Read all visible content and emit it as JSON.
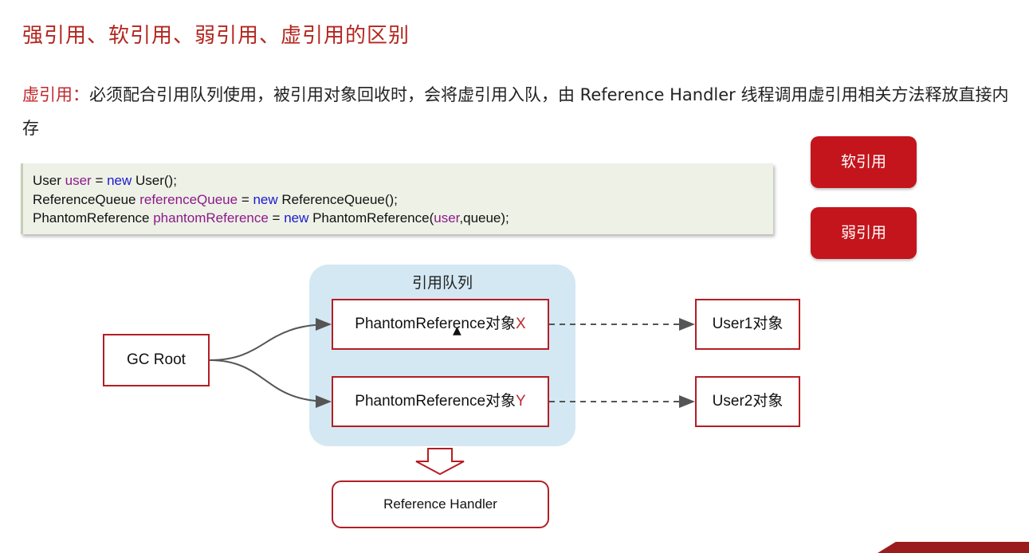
{
  "title": "强引用、软引用、弱引用、虚引用的区别",
  "description": {
    "highlight": "虚引用：",
    "text": "必须配合引用队列使用，被引用对象回收时，会将虚引用入队，由 Reference Handler 线程调用虚引用相关方法释放直接内存"
  },
  "code": {
    "line1": {
      "type": "User",
      "var": "user",
      "eq": " = ",
      "kw": "new",
      "rest": " User();"
    },
    "line2": {
      "type": "ReferenceQueue",
      "var": "referenceQueue",
      "eq": " = ",
      "kw": "new",
      "rest": " ReferenceQueue();"
    },
    "line3": {
      "type": "PhantomReference",
      "var": "phantomReference",
      "eq": " = ",
      "kw": "new",
      "rest1": " PhantomReference(",
      "arg": "user",
      "rest2": ",queue);"
    }
  },
  "buttons": {
    "soft": "软引用",
    "weak": "弱引用"
  },
  "diagram": {
    "queue_title": "引用队列",
    "gc_root": "GC Root",
    "phantom_x": {
      "label": "PhantomReference对象",
      "suffix": "X"
    },
    "phantom_y": {
      "label": "PhantomReference对象",
      "suffix": "Y"
    },
    "user1": "User1对象",
    "user2": "User2对象",
    "reference_handler": "Reference Handler"
  },
  "colors": {
    "accent": "#c4151c",
    "queue_bg": "#d3e8f2",
    "code_bg": "#eef1e6"
  }
}
